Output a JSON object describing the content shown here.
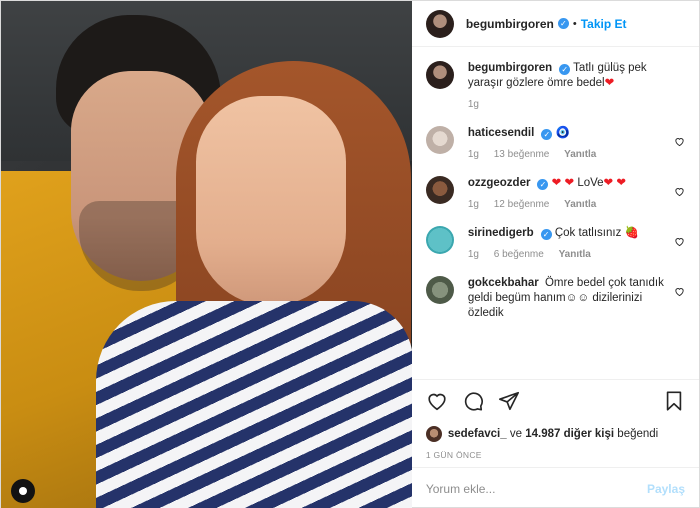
{
  "header": {
    "username": "begumbirgoren",
    "separator": "•",
    "follow_label": "Takip Et"
  },
  "caption": {
    "username": "begumbirgoren",
    "text": "Tatlı gülüş pek yaraşır gözlere ömre bedel",
    "emoji": "❤",
    "time": "1g"
  },
  "comments": [
    {
      "username": "haticesendil",
      "text": "🧿",
      "time": "1g",
      "likes": "13 beğenme",
      "reply": "Yanıtla"
    },
    {
      "username": "ozzgeozder",
      "text_prefix": "❤ ❤",
      "text": " LoVe",
      "text_suffix": "❤ ❤",
      "time": "1g",
      "likes": "12 beğenme",
      "reply": "Yanıtla"
    },
    {
      "username": "sirinedigerb",
      "text": "Çok tatlısınız 🍓",
      "time": "1g",
      "likes": "6 beğenme",
      "reply": "Yanıtla"
    },
    {
      "username": "gokcekbahar",
      "text": "Ömre bedel çok tanıdık geldi begüm hanım☺☺ dizilerinizi özledik"
    }
  ],
  "likes": {
    "user": "sedefavci_",
    "connector": "ve",
    "others": "14.987 diğer kişi",
    "suffix": "beğendi"
  },
  "date": "1 GÜN ÖNCE",
  "comment_input": {
    "placeholder": "Yorum ekle...",
    "post_label": "Paylaş"
  },
  "colors": {
    "accent": "#0095f6",
    "verified": "#3897f0",
    "muted": "#8e8e8e"
  },
  "icons": [
    "heart-icon",
    "comment-icon",
    "share-icon",
    "bookmark-icon",
    "verified-icon"
  ]
}
